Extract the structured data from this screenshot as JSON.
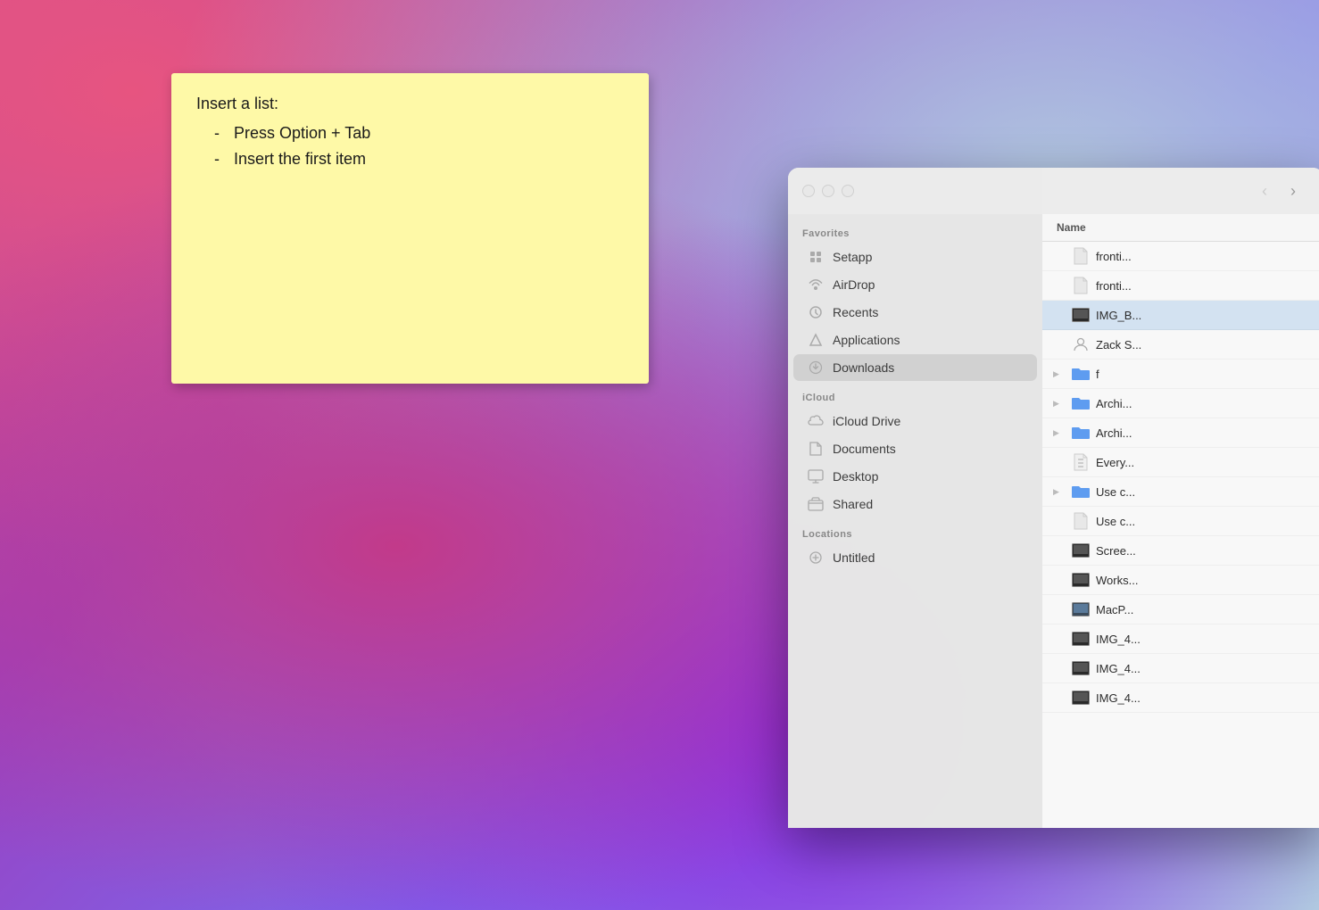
{
  "wallpaper": {
    "description": "macOS Big Sur wallpaper with purple and pink gradient"
  },
  "sticky_note": {
    "title": "Insert a list:",
    "items": [
      {
        "dash": "-",
        "text": "Press Option + Tab"
      },
      {
        "dash": "-",
        "text": "Insert the first item"
      }
    ]
  },
  "finder": {
    "titlebar": {
      "back_label": "‹",
      "forward_label": "›"
    },
    "sidebar": {
      "sections": [
        {
          "label": "Favorites",
          "items": [
            {
              "id": "setapp",
              "icon": "⚙",
              "name": "Setapp"
            },
            {
              "id": "airdrop",
              "icon": "📡",
              "name": "AirDrop"
            },
            {
              "id": "recents",
              "icon": "🕐",
              "name": "Recents"
            },
            {
              "id": "applications",
              "icon": "✦",
              "name": "Applications"
            },
            {
              "id": "downloads",
              "icon": "⬇",
              "name": "Downloads",
              "active": true
            }
          ]
        },
        {
          "label": "iCloud",
          "items": [
            {
              "id": "icloud-drive",
              "icon": "☁",
              "name": "iCloud Drive"
            },
            {
              "id": "documents",
              "icon": "📄",
              "name": "Documents"
            },
            {
              "id": "desktop",
              "icon": "🖥",
              "name": "Desktop"
            },
            {
              "id": "shared",
              "icon": "📁",
              "name": "Shared"
            }
          ]
        },
        {
          "label": "Locations",
          "items": [
            {
              "id": "untitled",
              "icon": "💾",
              "name": "Untitled"
            }
          ]
        }
      ]
    },
    "file_list": {
      "header": "Name",
      "items": [
        {
          "id": "fronti1",
          "name": "fronti...",
          "icon": "doc",
          "hasChevron": false,
          "selected": false
        },
        {
          "id": "fronti2",
          "name": "fronti...",
          "icon": "doc",
          "hasChevron": false,
          "selected": false
        },
        {
          "id": "img_b",
          "name": "IMG_B...",
          "icon": "img",
          "hasChevron": false,
          "selected": true
        },
        {
          "id": "zack",
          "name": "Zack S...",
          "icon": "contact",
          "hasChevron": false,
          "selected": false
        },
        {
          "id": "f",
          "name": "f",
          "icon": "folder",
          "hasChevron": true,
          "selected": false
        },
        {
          "id": "archi1",
          "name": "Archi...",
          "icon": "folder",
          "hasChevron": true,
          "selected": false
        },
        {
          "id": "archi2",
          "name": "Archi...",
          "icon": "folder",
          "hasChevron": true,
          "selected": false
        },
        {
          "id": "every",
          "name": "Every...",
          "icon": "zip",
          "hasChevron": false,
          "selected": false
        },
        {
          "id": "usec1",
          "name": "Use c...",
          "icon": "folder",
          "hasChevron": true,
          "selected": false
        },
        {
          "id": "usec2",
          "name": "Use c...",
          "icon": "doc",
          "hasChevron": false,
          "selected": false
        },
        {
          "id": "scree",
          "name": "Scree...",
          "icon": "img",
          "hasChevron": false,
          "selected": false
        },
        {
          "id": "works",
          "name": "Works...",
          "icon": "img",
          "hasChevron": false,
          "selected": false
        },
        {
          "id": "macp",
          "name": "MacP...",
          "icon": "img",
          "hasChevron": false,
          "selected": false
        },
        {
          "id": "img4a",
          "name": "IMG_4...",
          "icon": "img",
          "hasChevron": false,
          "selected": false
        },
        {
          "id": "img4b",
          "name": "IMG_4...",
          "icon": "img",
          "hasChevron": false,
          "selected": false
        },
        {
          "id": "img4c",
          "name": "IMG_4...",
          "icon": "img",
          "hasChevron": false,
          "selected": false
        }
      ]
    }
  }
}
